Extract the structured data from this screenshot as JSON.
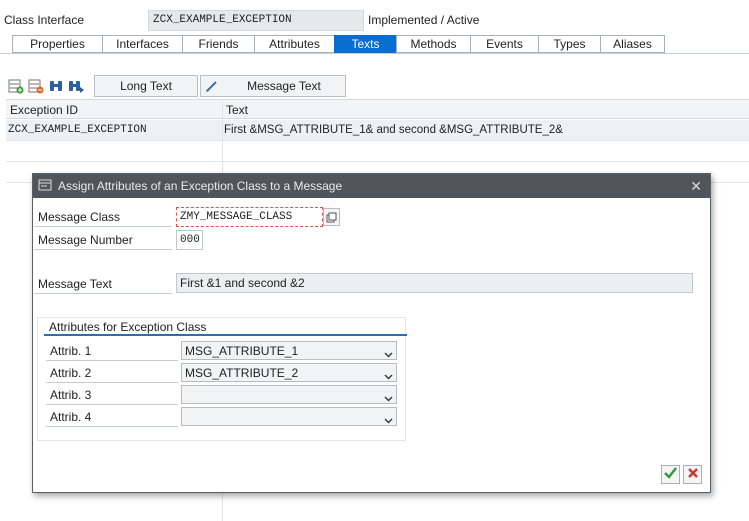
{
  "header": {
    "label": "Class Interface",
    "class_name": "ZCX_EXAMPLE_EXCEPTION",
    "status": "Implemented / Active"
  },
  "tabs": [
    {
      "label": "Properties"
    },
    {
      "label": "Interfaces"
    },
    {
      "label": "Friends"
    },
    {
      "label": "Attributes"
    },
    {
      "label": "Texts",
      "active": true
    },
    {
      "label": "Methods"
    },
    {
      "label": "Events"
    },
    {
      "label": "Types"
    },
    {
      "label": "Aliases"
    }
  ],
  "toolbar": {
    "long_text": "Long Text",
    "message_text": "Message Text"
  },
  "table": {
    "columns": [
      "Exception ID",
      "Text"
    ],
    "rows": [
      {
        "id": "ZCX_EXAMPLE_EXCEPTION",
        "text": "First &MSG_ATTRIBUTE_1& and second &MSG_ATTRIBUTE_2&"
      }
    ]
  },
  "dialog": {
    "title": "Assign Attributes of an Exception Class to a Message",
    "message_class_label": "Message Class",
    "message_class_value": "ZMY_MESSAGE_CLASS",
    "message_number_label": "Message Number",
    "message_number_value": "000",
    "message_text_label": "Message Text",
    "message_text_value": "First &1 and second &2",
    "group_title": "Attributes for Exception Class",
    "attributes": [
      {
        "label": "Attrib. 1",
        "value": "MSG_ATTRIBUTE_1"
      },
      {
        "label": "Attrib. 2",
        "value": "MSG_ATTRIBUTE_2"
      },
      {
        "label": "Attrib. 3",
        "value": ""
      },
      {
        "label": "Attrib. 4",
        "value": ""
      }
    ]
  },
  "colors": {
    "active_tab": "#0a6ed1",
    "dialog_title_bar": "#4f555b",
    "ok_green": "#2e9a3a",
    "cancel_red": "#d0342c"
  }
}
